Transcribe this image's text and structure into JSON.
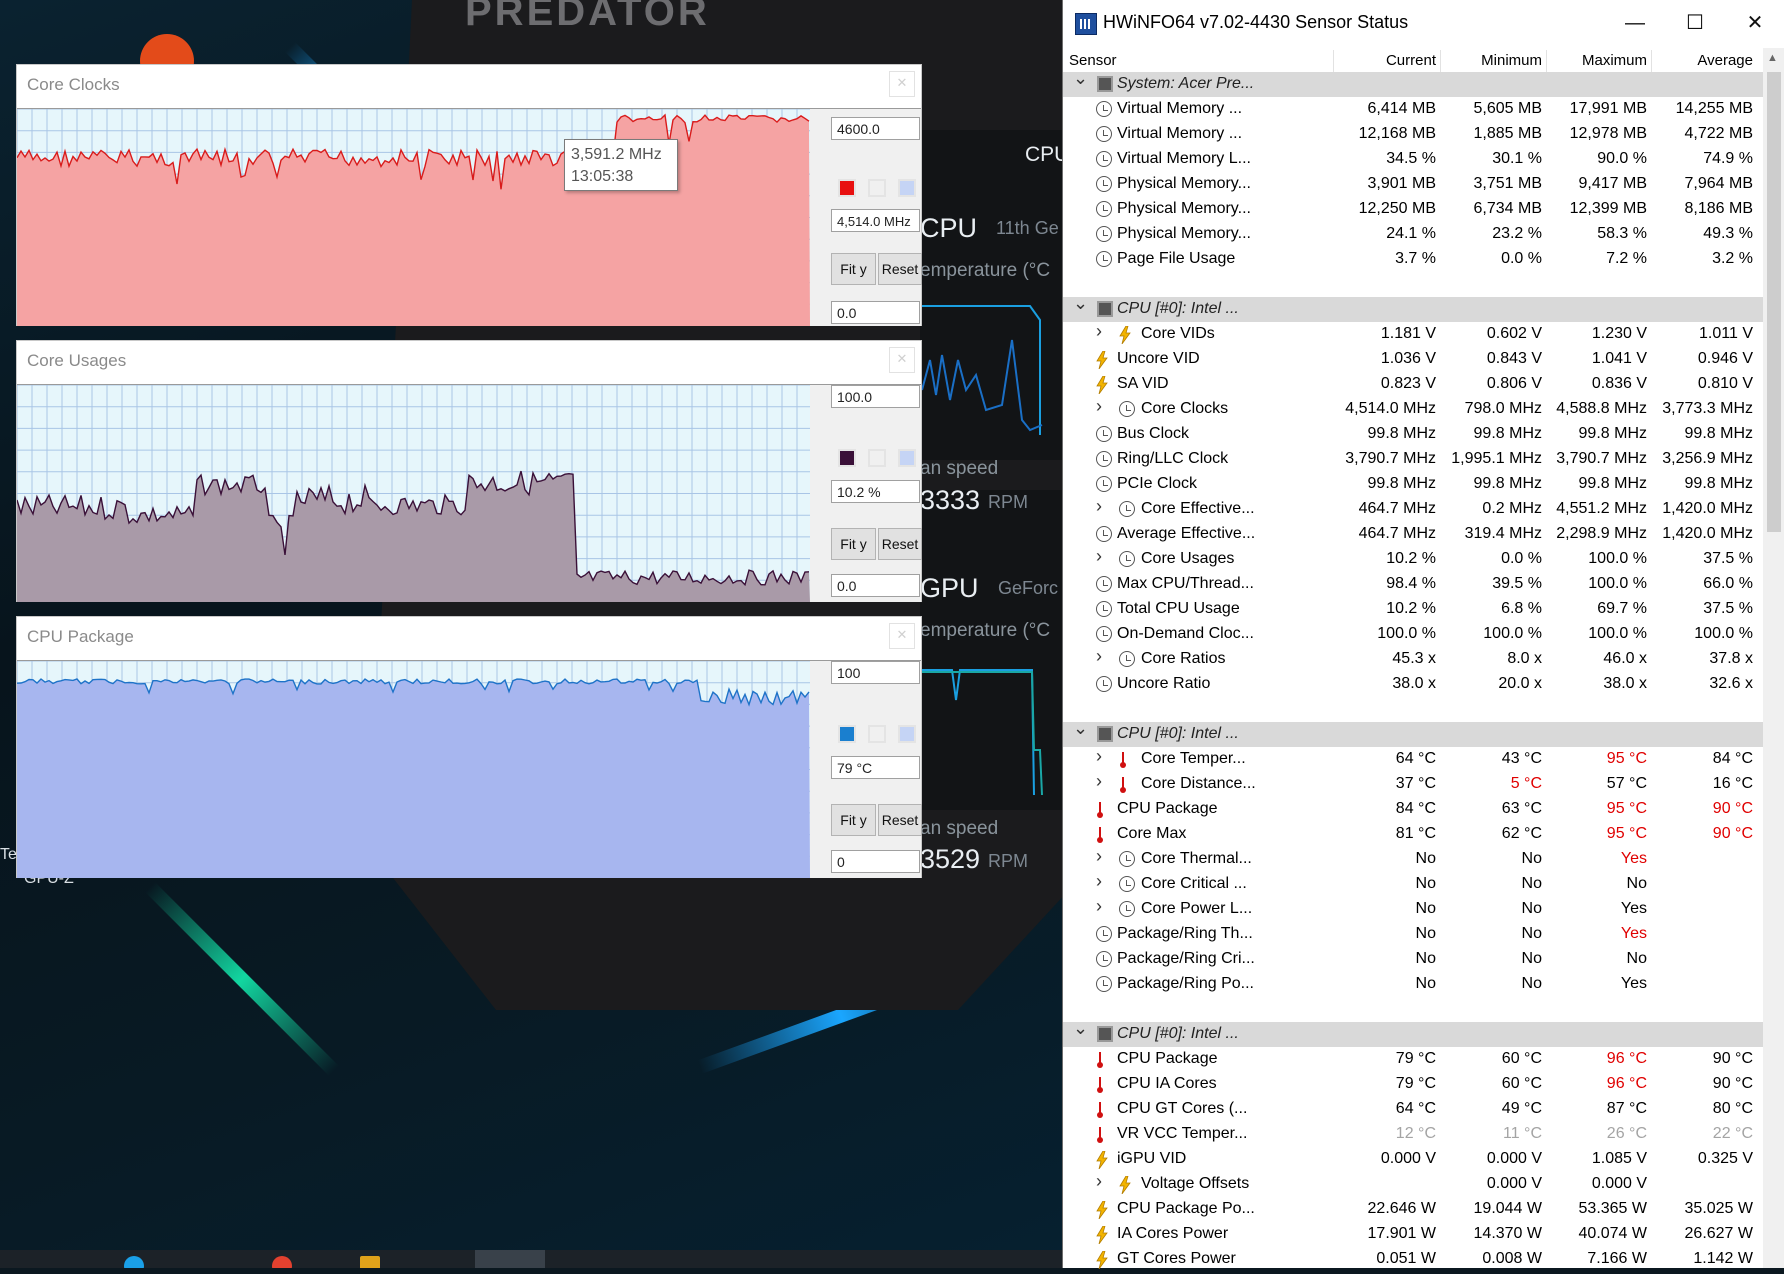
{
  "desktop": {
    "brand_logo": "PREDATOR",
    "cpu_header": "CPU",
    "cpu_label": "CPU",
    "cpu_gen": "11th Ge",
    "cpu_temp_label": "emperature (°C",
    "cpu_fan_label": "an speed",
    "cpu_fan_value": "3333",
    "cpu_fan_unit": "RPM",
    "gpu_label": "GPU",
    "gpu_name": "GeForc",
    "gpu_temp_label": "emperature (°C",
    "gpu_fan_label": "an speed",
    "gpu_fan_value": "3529",
    "gpu_fan_unit": "RPM",
    "icon_label": "GPU-Z",
    "icon_label2": "Te"
  },
  "graphs": [
    {
      "title": "Core Clocks",
      "max_value": "4600.0",
      "current_value": "4,514.0 MHz",
      "min_value": "0.0",
      "fit_label": "Fit y",
      "reset_label": "Reset",
      "swatch_color": "#e81010",
      "fill_color": "#f5a3a3",
      "line_color": "#d91b1b",
      "tooltip_value": "3,591.2 MHz",
      "tooltip_time": "13:05:38"
    },
    {
      "title": "Core Usages",
      "max_value": "100.0",
      "current_value": "10.2 %",
      "min_value": "0.0",
      "fit_label": "Fit y",
      "reset_label": "Reset",
      "swatch_color": "#3a1038",
      "fill_color": "#a99aa8",
      "line_color": "#3a1038"
    },
    {
      "title": "CPU Package",
      "max_value": "100",
      "current_value": "79 °C",
      "min_value": "0",
      "fit_label": "Fit y",
      "reset_label": "Reset",
      "swatch_color": "#1a7fcf",
      "fill_color": "#a7b6ef",
      "line_color": "#1e73c8"
    }
  ],
  "hwinfo": {
    "title": "HWiNFO64 v7.02-4430 Sensor Status",
    "columns": [
      "Sensor",
      "Current",
      "Minimum",
      "Maximum",
      "Average"
    ],
    "rows": [
      {
        "type": "group",
        "name": "System: Acer Pre..."
      },
      {
        "icon": "clock",
        "name": "Virtual Memory ...",
        "v": [
          "6,414 MB",
          "5,605 MB",
          "17,991 MB",
          "14,255 MB"
        ]
      },
      {
        "icon": "clock",
        "name": "Virtual Memory ...",
        "v": [
          "12,168 MB",
          "1,885 MB",
          "12,978 MB",
          "4,722 MB"
        ]
      },
      {
        "icon": "clock",
        "name": "Virtual Memory L...",
        "v": [
          "34.5 %",
          "30.1 %",
          "90.0 %",
          "74.9 %"
        ]
      },
      {
        "icon": "clock",
        "name": "Physical Memory...",
        "v": [
          "3,901 MB",
          "3,751 MB",
          "9,417 MB",
          "7,964 MB"
        ]
      },
      {
        "icon": "clock",
        "name": "Physical Memory...",
        "v": [
          "12,250 MB",
          "6,734 MB",
          "12,399 MB",
          "8,186 MB"
        ]
      },
      {
        "icon": "clock",
        "name": "Physical Memory...",
        "v": [
          "24.1 %",
          "23.2 %",
          "58.3 %",
          "49.3 %"
        ]
      },
      {
        "icon": "clock",
        "name": "Page File Usage",
        "v": [
          "3.7 %",
          "0.0 %",
          "7.2 %",
          "3.2 %"
        ]
      },
      {
        "type": "blank"
      },
      {
        "type": "group",
        "name": "CPU [#0]: Intel ..."
      },
      {
        "icon": "volt",
        "expand": true,
        "name": "Core VIDs",
        "v": [
          "1.181 V",
          "0.602 V",
          "1.230 V",
          "1.011 V"
        ]
      },
      {
        "icon": "volt",
        "name": "Uncore VID",
        "v": [
          "1.036 V",
          "0.843 V",
          "1.041 V",
          "0.946 V"
        ]
      },
      {
        "icon": "volt",
        "name": "SA VID",
        "v": [
          "0.823 V",
          "0.806 V",
          "0.836 V",
          "0.810 V"
        ]
      },
      {
        "icon": "clock",
        "expand": true,
        "name": "Core Clocks",
        "v": [
          "4,514.0 MHz",
          "798.0 MHz",
          "4,588.8 MHz",
          "3,773.3 MHz"
        ]
      },
      {
        "icon": "clock",
        "name": "Bus Clock",
        "v": [
          "99.8 MHz",
          "99.8 MHz",
          "99.8 MHz",
          "99.8 MHz"
        ]
      },
      {
        "icon": "clock",
        "name": "Ring/LLC Clock",
        "v": [
          "3,790.7 MHz",
          "1,995.1 MHz",
          "3,790.7 MHz",
          "3,256.9 MHz"
        ]
      },
      {
        "icon": "clock",
        "name": "PCIe Clock",
        "v": [
          "99.8 MHz",
          "99.8 MHz",
          "99.8 MHz",
          "99.8 MHz"
        ]
      },
      {
        "icon": "clock",
        "expand": true,
        "name": "Core Effective...",
        "v": [
          "464.7 MHz",
          "0.2 MHz",
          "4,551.2 MHz",
          "1,420.0 MHz"
        ]
      },
      {
        "icon": "clock",
        "name": "Average Effective...",
        "v": [
          "464.7 MHz",
          "319.4 MHz",
          "2,298.9 MHz",
          "1,420.0 MHz"
        ]
      },
      {
        "icon": "clock",
        "expand": true,
        "name": "Core Usages",
        "v": [
          "10.2 %",
          "0.0 %",
          "100.0 %",
          "37.5 %"
        ]
      },
      {
        "icon": "clock",
        "name": "Max CPU/Thread...",
        "v": [
          "98.4 %",
          "39.5 %",
          "100.0 %",
          "66.0 %"
        ]
      },
      {
        "icon": "clock",
        "name": "Total CPU Usage",
        "v": [
          "10.2 %",
          "6.8 %",
          "69.7 %",
          "37.5 %"
        ]
      },
      {
        "icon": "clock",
        "name": "On-Demand Cloc...",
        "v": [
          "100.0 %",
          "100.0 %",
          "100.0 %",
          "100.0 %"
        ]
      },
      {
        "icon": "clock",
        "expand": true,
        "name": "Core Ratios",
        "v": [
          "45.3 x",
          "8.0 x",
          "46.0 x",
          "37.8 x"
        ]
      },
      {
        "icon": "clock",
        "name": "Uncore Ratio",
        "v": [
          "38.0 x",
          "20.0 x",
          "38.0 x",
          "32.6 x"
        ]
      },
      {
        "type": "blank"
      },
      {
        "type": "group",
        "name": "CPU [#0]: Intel ..."
      },
      {
        "icon": "temp",
        "expand": true,
        "name": "Core Temper...",
        "v": [
          "64 °C",
          "43 °C",
          "95 °C",
          "84 °C"
        ],
        "red": [
          2
        ]
      },
      {
        "icon": "temp",
        "expand": true,
        "name": "Core Distance...",
        "v": [
          "37 °C",
          "5 °C",
          "57 °C",
          "16 °C"
        ],
        "red": [
          1
        ]
      },
      {
        "icon": "temp",
        "name": "CPU Package",
        "v": [
          "84 °C",
          "63 °C",
          "95 °C",
          "90 °C"
        ],
        "red": [
          2,
          3
        ]
      },
      {
        "icon": "temp",
        "name": "Core Max",
        "v": [
          "81 °C",
          "62 °C",
          "95 °C",
          "90 °C"
        ],
        "red": [
          2,
          3
        ]
      },
      {
        "icon": "clock",
        "expand": true,
        "name": "Core Thermal...",
        "v": [
          "No",
          "No",
          "Yes",
          ""
        ],
        "red": [
          2
        ]
      },
      {
        "icon": "clock",
        "expand": true,
        "name": "Core Critical ...",
        "v": [
          "No",
          "No",
          "No",
          ""
        ]
      },
      {
        "icon": "clock",
        "expand": true,
        "name": "Core Power L...",
        "v": [
          "No",
          "No",
          "Yes",
          ""
        ]
      },
      {
        "icon": "clock",
        "name": "Package/Ring Th...",
        "v": [
          "No",
          "No",
          "Yes",
          ""
        ],
        "red": [
          2
        ]
      },
      {
        "icon": "clock",
        "name": "Package/Ring Cri...",
        "v": [
          "No",
          "No",
          "No",
          ""
        ]
      },
      {
        "icon": "clock",
        "name": "Package/Ring Po...",
        "v": [
          "No",
          "No",
          "Yes",
          ""
        ]
      },
      {
        "type": "blank"
      },
      {
        "type": "group",
        "name": "CPU [#0]: Intel ..."
      },
      {
        "icon": "temp",
        "name": "CPU Package",
        "v": [
          "79 °C",
          "60 °C",
          "96 °C",
          "90 °C"
        ],
        "red": [
          2
        ]
      },
      {
        "icon": "temp",
        "name": "CPU IA Cores",
        "v": [
          "79 °C",
          "60 °C",
          "96 °C",
          "90 °C"
        ],
        "red": [
          2
        ]
      },
      {
        "icon": "temp",
        "name": "CPU GT Cores (...",
        "v": [
          "64 °C",
          "49 °C",
          "87 °C",
          "80 °C"
        ]
      },
      {
        "icon": "temp",
        "name": "VR VCC Temper...",
        "v": [
          "12 °C",
          "11 °C",
          "26 °C",
          "22 °C"
        ],
        "grey": true
      },
      {
        "icon": "volt",
        "name": "iGPU VID",
        "v": [
          "0.000 V",
          "0.000 V",
          "1.085 V",
          "0.325 V"
        ]
      },
      {
        "icon": "volt",
        "expand": true,
        "name": "Voltage Offsets",
        "v": [
          "",
          "0.000 V",
          "0.000 V",
          ""
        ]
      },
      {
        "icon": "volt",
        "name": "CPU Package Po...",
        "v": [
          "22.646 W",
          "19.044 W",
          "53.365 W",
          "35.025 W"
        ]
      },
      {
        "icon": "volt",
        "name": "IA Cores Power",
        "v": [
          "17.901 W",
          "14.370 W",
          "40.074 W",
          "26.627 W"
        ]
      },
      {
        "icon": "volt",
        "name": "GT Cores Power",
        "v": [
          "0.051 W",
          "0.008 W",
          "7.166 W",
          "1.142 W"
        ]
      }
    ]
  }
}
